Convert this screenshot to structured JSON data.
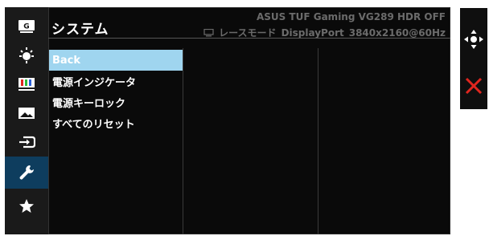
{
  "header": {
    "title": "システム",
    "model": "ASUS TUF Gaming VG289 HDR OFF",
    "mode_label": "レースモード",
    "input": "DisplayPort",
    "resolution": "3840x2160@60Hz"
  },
  "sidebar": {
    "items": [
      {
        "name": "gameplus",
        "label": "G"
      },
      {
        "name": "splendid"
      },
      {
        "name": "color"
      },
      {
        "name": "image"
      },
      {
        "name": "input-select"
      },
      {
        "name": "system-setup",
        "active": true
      },
      {
        "name": "favorite"
      }
    ]
  },
  "menu": {
    "items": [
      {
        "label": "Back",
        "selected": true
      },
      {
        "label": "電源インジケータ"
      },
      {
        "label": "電源キーロック"
      },
      {
        "label": "すべてのリセット"
      }
    ]
  },
  "colors": {
    "accent_selected": "#9fd5ef",
    "active_sidebar": "#0e3d5e",
    "close_red": "#e0261f"
  },
  "icons": [
    "navigate-icon",
    "close-icon"
  ]
}
